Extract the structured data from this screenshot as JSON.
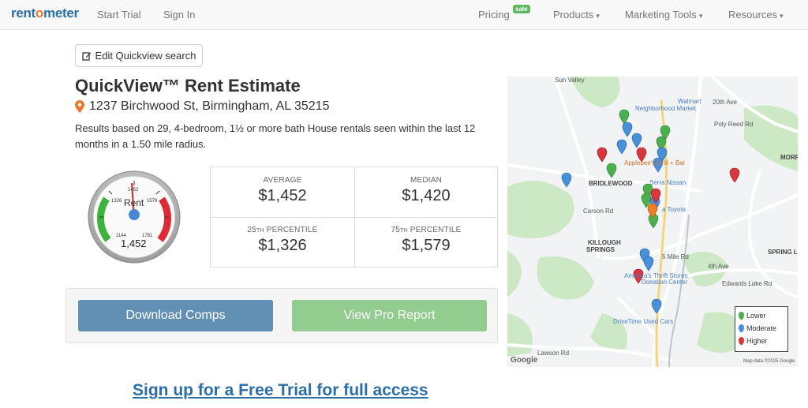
{
  "nav": {
    "logo_a": "rent",
    "logo_o": "o",
    "logo_b": "meter",
    "start_trial": "Start Trial",
    "sign_in": "Sign In",
    "pricing": "Pricing",
    "sale_badge": "sale",
    "products": "Products",
    "marketing_tools": "Marketing Tools",
    "resources": "Resources"
  },
  "edit_button": "Edit Quickview search",
  "title": "QuickView™ Rent Estimate",
  "address": "1237 Birchwood St, Birmingham, AL 35215",
  "description": "Results based on 29, 4-bedroom, 1½ or more bath House rentals seen within the last 12 months in a 1.50 mile radius.",
  "gauge": {
    "label": "Rent",
    "value": "1,452",
    "ticks": [
      "1144",
      "1326",
      "1452",
      "1579",
      "1781"
    ]
  },
  "stats": {
    "average_label": "AVERAGE",
    "average_value": "$1,452",
    "median_label": "MEDIAN",
    "median_value": "$1,420",
    "p25_prefix": "25",
    "p25_suffix": "TH",
    "p25_label": " PERCENTILE",
    "p25_value": "$1,326",
    "p75_prefix": "75",
    "p75_suffix": "TH",
    "p75_label": " PERCENTILE",
    "p75_value": "$1,579"
  },
  "buttons": {
    "download": "Download Comps",
    "pro_report": "View Pro Report"
  },
  "signup": "Sign up for a Free Trial for full access",
  "map": {
    "labels": {
      "walmart": "Walmart",
      "neighborhood_market": "Neighborhood Market",
      "applebees": "Applebee's Grill + Bar",
      "serra_nissan": "Serra Nissan",
      "toyota": "a Toyota",
      "bridlewood": "BRIDLEWOOD",
      "killough": "KILLOUGH",
      "springs": "SPRINGS",
      "americas_thrift": "America's Thrift Stores",
      "donation_center": "Donation Center",
      "drivetime": "DriveTime Used Cars",
      "morr": "MORR",
      "spring_la": "SPRING LA",
      "edwards_lake": "Edwards Lake Rd",
      "lawson": "Lawson Rd",
      "poly_reed": "Poly Reed Rd",
      "twentieth": "20th Ave",
      "fourth_ave": "4th Ave",
      "sun_valley": "Sun Valley",
      "carson": "Carson Rd",
      "five_mile": "5 Mile Rd"
    },
    "legend": {
      "lower": "Lower",
      "moderate": "Moderate",
      "higher": "Higher"
    },
    "google": "Google",
    "map_data": "Map data ©2025 Google"
  },
  "colors": {
    "brand_blue": "#2a6fa8",
    "brand_orange": "#e8782a",
    "pin_green": "#4caf50",
    "pin_blue": "#4a90d9",
    "pin_red": "#d9363e",
    "download_button": "#6290b4",
    "pro_button": "#92cc8f"
  }
}
